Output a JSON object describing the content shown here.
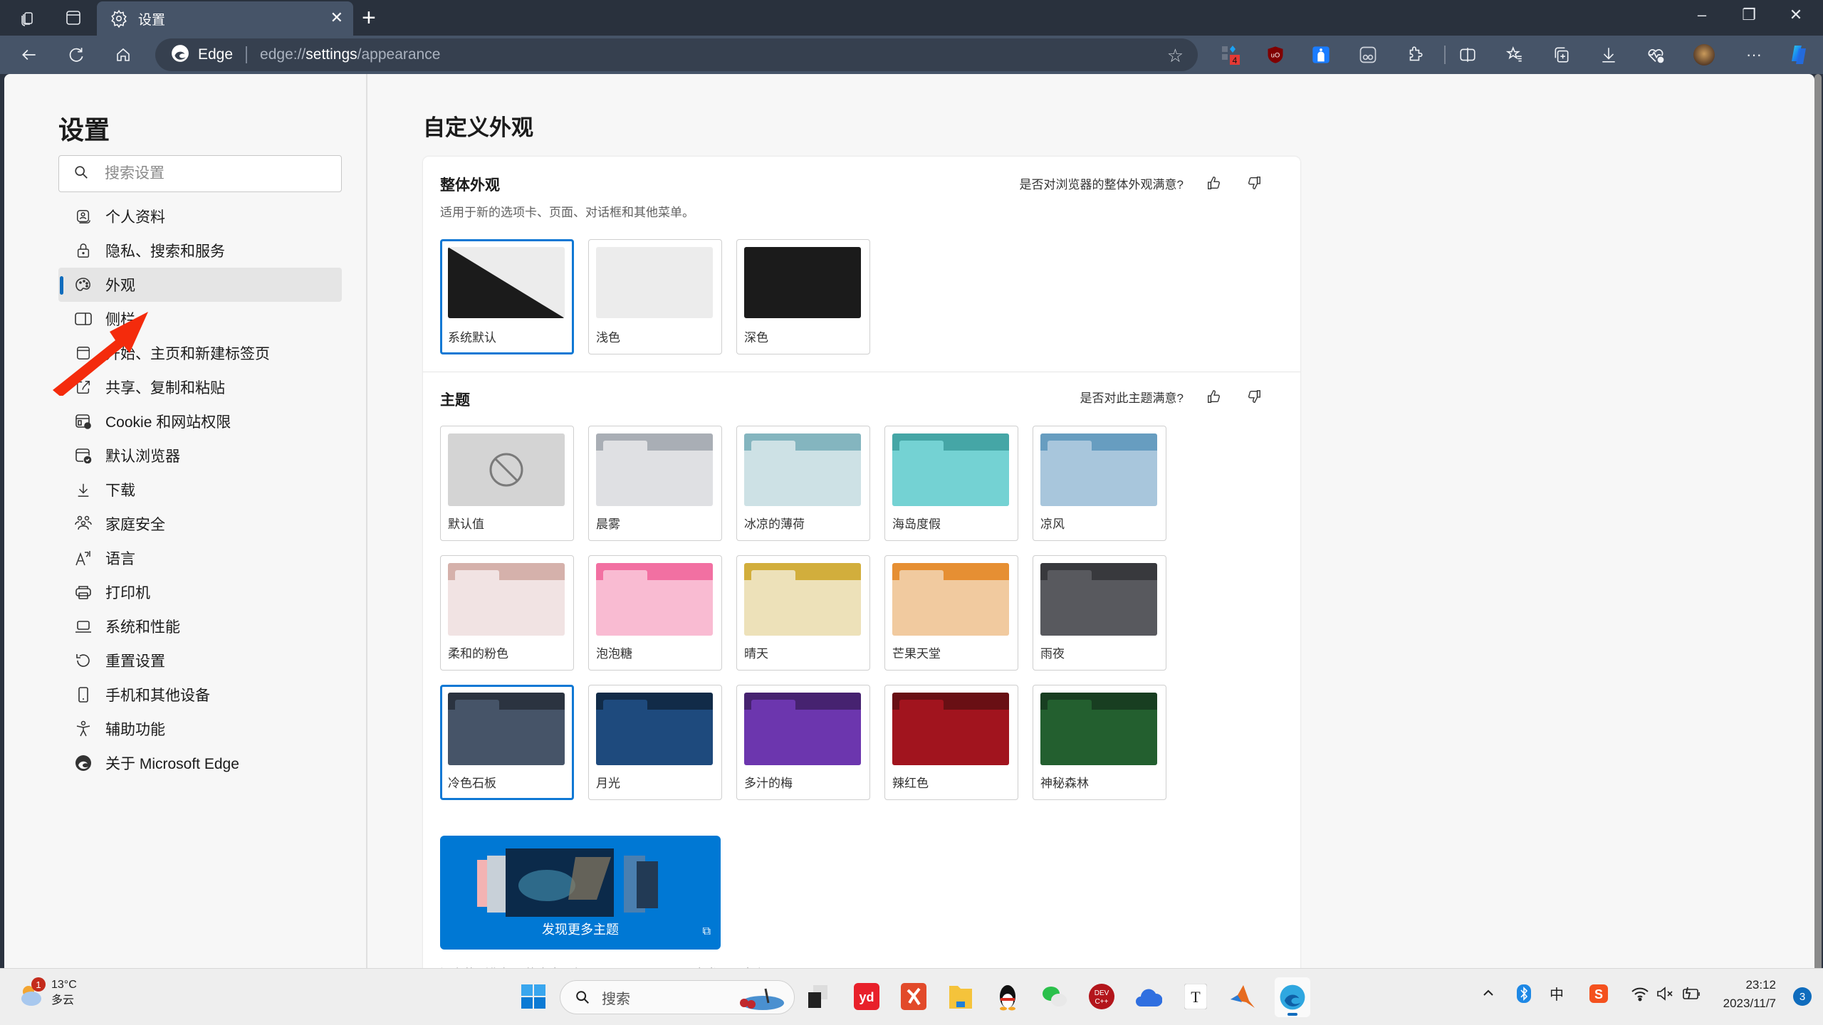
{
  "browser": {
    "tab": {
      "title": "设置",
      "icon": "gear-icon"
    },
    "new_tab_label": "+",
    "window_controls": {
      "minimize": "–",
      "restore": "❐",
      "close": "✕"
    },
    "omnibox": {
      "brand": "Edge",
      "url_prefix": "edge://",
      "url_host": "settings",
      "url_path": "/appearance"
    },
    "extensions": [
      {
        "name": "extension-icon-1",
        "badge": "4"
      },
      {
        "name": "ublock-icon",
        "badge": ""
      },
      {
        "name": "extension-icon-3",
        "badge": ""
      },
      {
        "name": "extension-icon-4",
        "badge": ""
      }
    ],
    "more_label": "···"
  },
  "sidebar": {
    "title": "设置",
    "search_placeholder": "搜索设置",
    "items": [
      {
        "label": "个人资料",
        "icon": "profile-icon",
        "active": false
      },
      {
        "label": "隐私、搜索和服务",
        "icon": "lock-icon",
        "active": false
      },
      {
        "label": "外观",
        "icon": "palette-icon",
        "active": true
      },
      {
        "label": "侧栏",
        "icon": "sidebar-icon",
        "active": false
      },
      {
        "label": "开始、主页和新建标签页",
        "icon": "home-tab-icon",
        "active": false
      },
      {
        "label": "共享、复制和粘贴",
        "icon": "share-icon",
        "active": false
      },
      {
        "label": "Cookie 和网站权限",
        "icon": "cookie-settings-icon",
        "active": false
      },
      {
        "label": "默认浏览器",
        "icon": "default-browser-icon",
        "active": false
      },
      {
        "label": "下载",
        "icon": "download-icon",
        "active": false
      },
      {
        "label": "家庭安全",
        "icon": "family-icon",
        "active": false
      },
      {
        "label": "语言",
        "icon": "language-icon",
        "active": false
      },
      {
        "label": "打印机",
        "icon": "printer-icon",
        "active": false
      },
      {
        "label": "系统和性能",
        "icon": "laptop-icon",
        "active": false
      },
      {
        "label": "重置设置",
        "icon": "reset-icon",
        "active": false
      },
      {
        "label": "手机和其他设备",
        "icon": "phone-icon",
        "active": false
      },
      {
        "label": "辅助功能",
        "icon": "accessibility-icon",
        "active": false
      },
      {
        "label": "关于 Microsoft Edge",
        "icon": "edge-logo-icon",
        "active": false
      }
    ]
  },
  "main": {
    "title": "自定义外观",
    "overall": {
      "heading": "整体外观",
      "description": "适用于新的选项卡、页面、对话框和其他菜单。",
      "feedback": "是否对浏览器的整体外观满意?",
      "options": [
        {
          "label": "系统默认",
          "selected": true
        },
        {
          "label": "浅色",
          "selected": false
        },
        {
          "label": "深色",
          "selected": false
        }
      ]
    },
    "themes": {
      "heading": "主题",
      "feedback": "是否对此主题满意?",
      "items": [
        {
          "label": "默认值",
          "top": "#d4d4d4",
          "tab": "#d4d4d4",
          "body": "#d4d4d4",
          "selected": false,
          "none": true
        },
        {
          "label": "晨雾",
          "top": "#a9aeb5",
          "tab": "#dfe0e3",
          "body": "#dfe0e3",
          "selected": false
        },
        {
          "label": "冰凉的薄荷",
          "top": "#84b5bf",
          "tab": "#cde1e5",
          "body": "#cde1e5",
          "selected": false
        },
        {
          "label": "海岛度假",
          "top": "#45a6a6",
          "tab": "#74d2d3",
          "body": "#74d2d3",
          "selected": false
        },
        {
          "label": "凉风",
          "top": "#679dc0",
          "tab": "#a8c6dc",
          "body": "#a8c6dc",
          "selected": false
        },
        {
          "label": "柔和的粉色",
          "top": "#d5b1ab",
          "tab": "#f1e3e3",
          "body": "#f1e3e3",
          "selected": false
        },
        {
          "label": "泡泡糖",
          "top": "#f270a2",
          "tab": "#f9bbd2",
          "body": "#f9bbd2",
          "selected": false
        },
        {
          "label": "晴天",
          "top": "#d2ae3c",
          "tab": "#ede1b9",
          "body": "#ede1b9",
          "selected": false
        },
        {
          "label": "芒果天堂",
          "top": "#e68f33",
          "tab": "#f1ca9f",
          "body": "#f1ca9f",
          "selected": false
        },
        {
          "label": "雨夜",
          "top": "#38393d",
          "tab": "#58595e",
          "body": "#58595e",
          "selected": false
        },
        {
          "label": "冷色石板",
          "top": "#2b3340",
          "tab": "#465468",
          "body": "#465468",
          "selected": true
        },
        {
          "label": "月光",
          "top": "#112b48",
          "tab": "#1e4a7d",
          "body": "#1e4a7d",
          "selected": false
        },
        {
          "label": "多汁的梅",
          "top": "#462270",
          "tab": "#6c36ae",
          "body": "#6c36ae",
          "selected": false
        },
        {
          "label": "辣红色",
          "top": "#690f14",
          "tab": "#a1141e",
          "body": "#a1141e",
          "selected": false
        },
        {
          "label": "神秘森林",
          "top": "#183e21",
          "tab": "#235f2f",
          "body": "#235f2f",
          "selected": false
        }
      ],
      "discover_label": "发现更多主题",
      "footer_before": "没有找到你想要的内容? 在 ",
      "footer_link": "Chrome Web Store",
      "footer_after": " 中发现更多主题。"
    }
  },
  "taskbar": {
    "weather": {
      "temp": "13°C",
      "condition": "多云",
      "badge": "1"
    },
    "search_placeholder": "搜索",
    "apps": [
      "start-icon",
      "task-view-icon",
      "youdao-icon",
      "xmind-icon",
      "file-explorer-icon",
      "qq-icon",
      "wechat-icon",
      "devcpp-icon",
      "cloud-drive-icon",
      "typora-icon",
      "matlab-icon",
      "edge-icon"
    ],
    "tray": {
      "ime": "中",
      "time": "23:12",
      "date": "2023/11/7",
      "notifications": "3"
    }
  }
}
